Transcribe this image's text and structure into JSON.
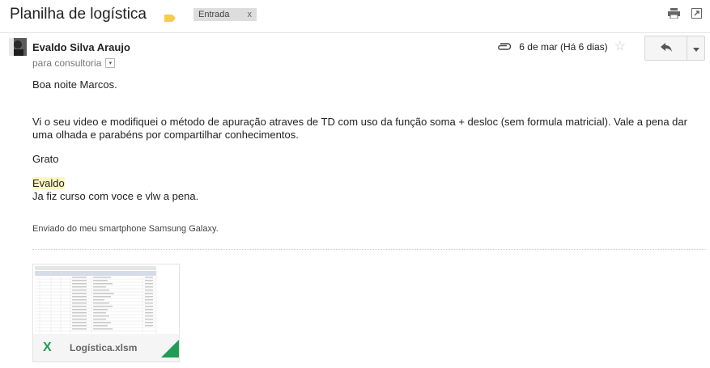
{
  "subject": "Planilha de logística",
  "label": {
    "name": "Entrada",
    "close": "x"
  },
  "sender": {
    "name": "Evaldo Silva Araujo",
    "to": "para consultoria"
  },
  "meta": {
    "date": "6 de mar (Há 6 dias)",
    "star": "☆"
  },
  "icons": {
    "print": "print-icon",
    "popout": "new-window-icon",
    "paperclip": "paperclip-icon",
    "reply": "reply-icon",
    "more": "chevron-down-icon"
  },
  "body": {
    "greeting": "Boa noite Marcos.",
    "paragraph": "Vi o seu video e modifiquei o método de apuração atraves de TD com uso da função soma + desloc (sem formula matricial). Vale a pena dar uma olhada e parabéns por compartilhar conhecimentos.",
    "thanks": "Grato",
    "name": "Evaldo",
    "ps": "Ja fiz curso com voce e vlw a pena.",
    "signature": "Enviado do meu smartphone Samsung Galaxy."
  },
  "attachment": {
    "filename": "Logística.xlsm",
    "icon_letter": "X",
    "accent": "#1f9d55"
  },
  "colors": {
    "highlight": "#fff7c0",
    "label_bg": "#dddddd"
  }
}
